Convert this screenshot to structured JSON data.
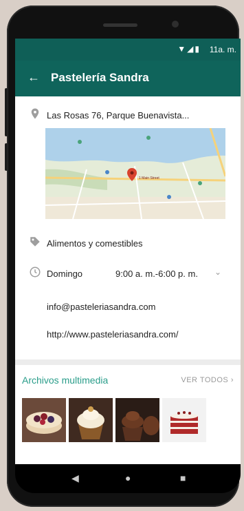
{
  "status_bar": {
    "time": "11a. m.",
    "icons": "▼◢▮"
  },
  "app_bar": {
    "back_icon": "←",
    "title": "Pastelería Sandra"
  },
  "business": {
    "address": "Las Rosas 76, Parque Buenavista...",
    "category": "Alimentos y comestibles",
    "hours": {
      "day": "Domingo",
      "time": "9:00 a. m.-6:00 p. m."
    },
    "email": "info@pasteleriasandra.com",
    "website": "http://www.pasteleriasandra.com/"
  },
  "map": {
    "marker_label": "1 Main Street"
  },
  "media": {
    "title": "Archivos multimedia",
    "see_all": "VER TODOS"
  },
  "nav": {
    "back_glyph": "◀",
    "home_glyph": "●",
    "recents_glyph": "■"
  },
  "colors": {
    "primary": "#0f645b",
    "accent": "#2a9d8a"
  }
}
